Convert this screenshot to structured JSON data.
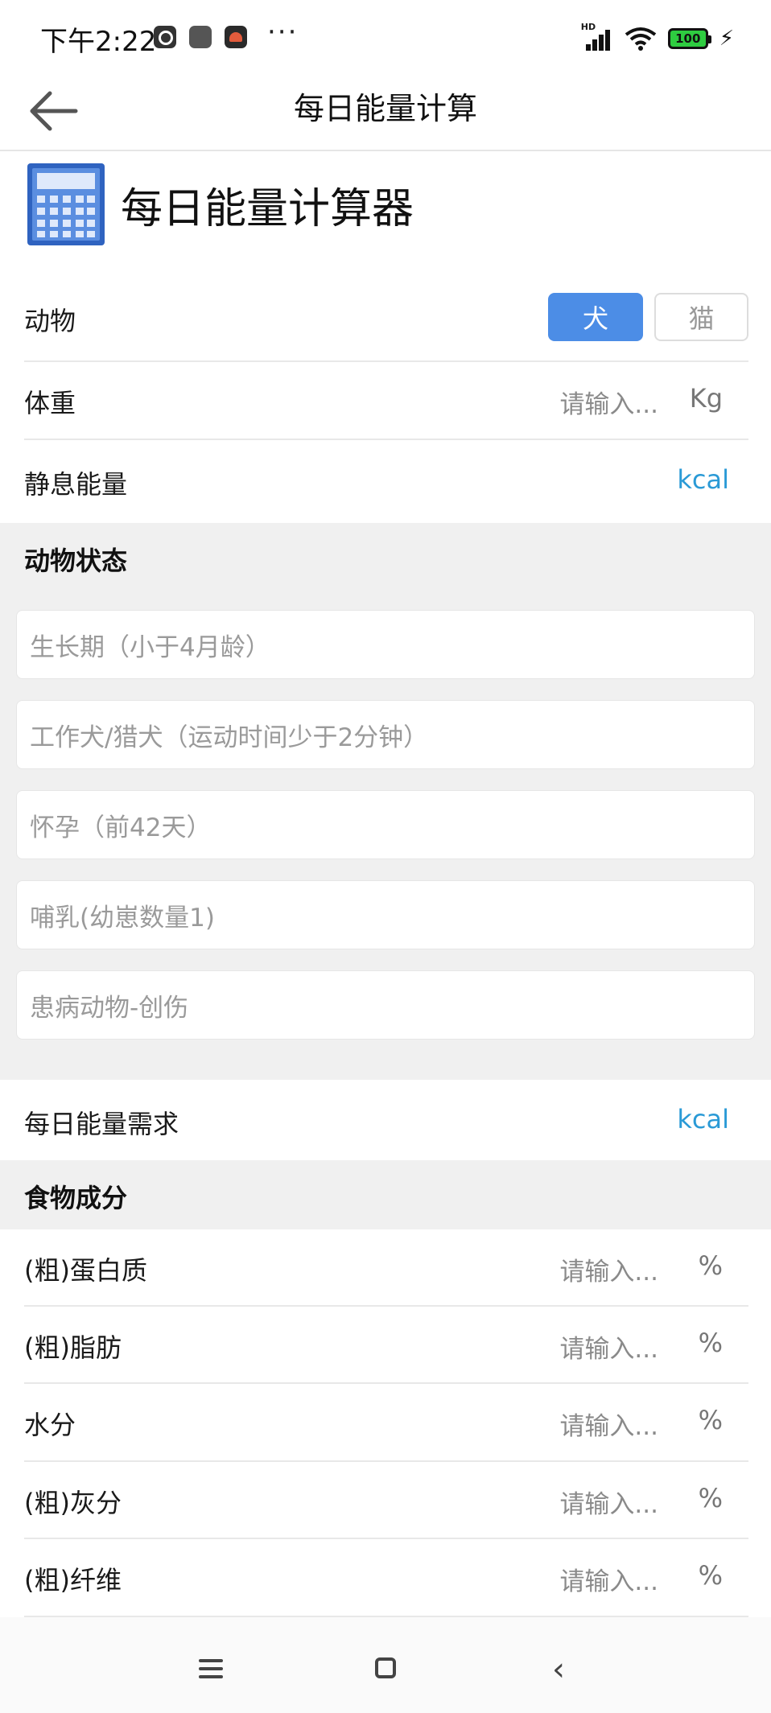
{
  "status_bar": {
    "time": "下午2:22",
    "more": "···",
    "network": "HD",
    "battery": "100"
  },
  "app_bar": {
    "title": "每日能量计算"
  },
  "header": {
    "title": "每日能量计算器"
  },
  "animal_row": {
    "label": "动物",
    "options": [
      "犬",
      "猫"
    ],
    "selected": "犬"
  },
  "weight_row": {
    "label": "体重",
    "placeholder": "请输入...",
    "unit": "Kg"
  },
  "rer_row": {
    "label": "静息能量",
    "unit": "kcal"
  },
  "animal_state": {
    "title": "动物状态",
    "fields": [
      "生长期（小于4月龄）",
      "工作犬/猎犬（运动时间少于2分钟）",
      "怀孕（前42天）",
      "哺乳(幼崽数量1)",
      "患病动物-创伤"
    ]
  },
  "der_row": {
    "label": "每日能量需求",
    "unit": "kcal"
  },
  "food": {
    "title": "食物成分",
    "rows": [
      {
        "label": "(粗)蛋白质",
        "placeholder": "请输入...",
        "unit": "%"
      },
      {
        "label": "(粗)脂肪",
        "placeholder": "请输入...",
        "unit": "%"
      },
      {
        "label": "水分",
        "placeholder": "请输入...",
        "unit": "%"
      },
      {
        "label": "(粗)灰分",
        "placeholder": "请输入...",
        "unit": "%"
      },
      {
        "label": "(粗)纤维",
        "placeholder": "请输入...",
        "unit": "%"
      }
    ]
  },
  "colors": {
    "accent_blue": "#4c8de6",
    "kcal_blue": "#2a9ad6",
    "section_gray": "#f0f0f0",
    "calculator_blue": "#2f63c0"
  },
  "icons": [
    "back-arrow-icon",
    "calculator-icon",
    "menu-icon",
    "home-icon",
    "nav-back-icon"
  ]
}
